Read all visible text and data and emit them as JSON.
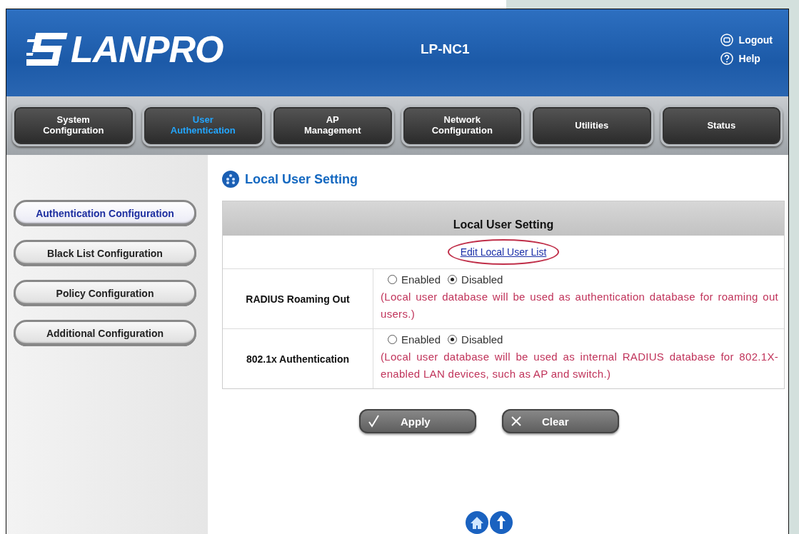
{
  "header": {
    "logo": "LANPRO",
    "model": "LP-NC1",
    "links": [
      {
        "kind": "logout",
        "label": "Logout"
      },
      {
        "kind": "help",
        "label": "Help"
      }
    ]
  },
  "tabs": [
    {
      "label": "System Configuration",
      "selected": false
    },
    {
      "label": "User Authentication",
      "selected": true
    },
    {
      "label": "AP Management",
      "selected": false
    },
    {
      "label": "Network Configuration",
      "selected": false
    },
    {
      "label": "Utilities",
      "selected": false
    },
    {
      "label": "Status",
      "selected": false
    }
  ],
  "sidebar": {
    "items": [
      {
        "label": "Authentication Configuration",
        "selected": true
      },
      {
        "label": "Black List Configuration",
        "selected": false
      },
      {
        "label": "Policy Configuration",
        "selected": false
      },
      {
        "label": "Additional Configuration",
        "selected": false
      }
    ]
  },
  "page_title": "Local User Setting",
  "panel": {
    "title": "Local User Setting",
    "link": {
      "label": "Edit Local User List",
      "circled": true
    },
    "rows": [
      {
        "label": "RADIUS Roaming Out",
        "options": [
          {
            "label": "Enabled",
            "selected": false
          },
          {
            "label": "Disabled",
            "selected": true
          }
        ],
        "note": "(Local user database will be used as authentication database for roaming out users.)"
      },
      {
        "label": "802.1x Authentication",
        "options": [
          {
            "label": "Enabled",
            "selected": false
          },
          {
            "label": "Disabled",
            "selected": true
          }
        ],
        "note": "(Local user database will be used as internal RADIUS database for 802.1X-enabled LAN devices, such as AP and switch.)"
      }
    ]
  },
  "buttons": [
    {
      "kind": "apply",
      "label": "Apply"
    },
    {
      "kind": "clear",
      "label": "Clear"
    }
  ]
}
